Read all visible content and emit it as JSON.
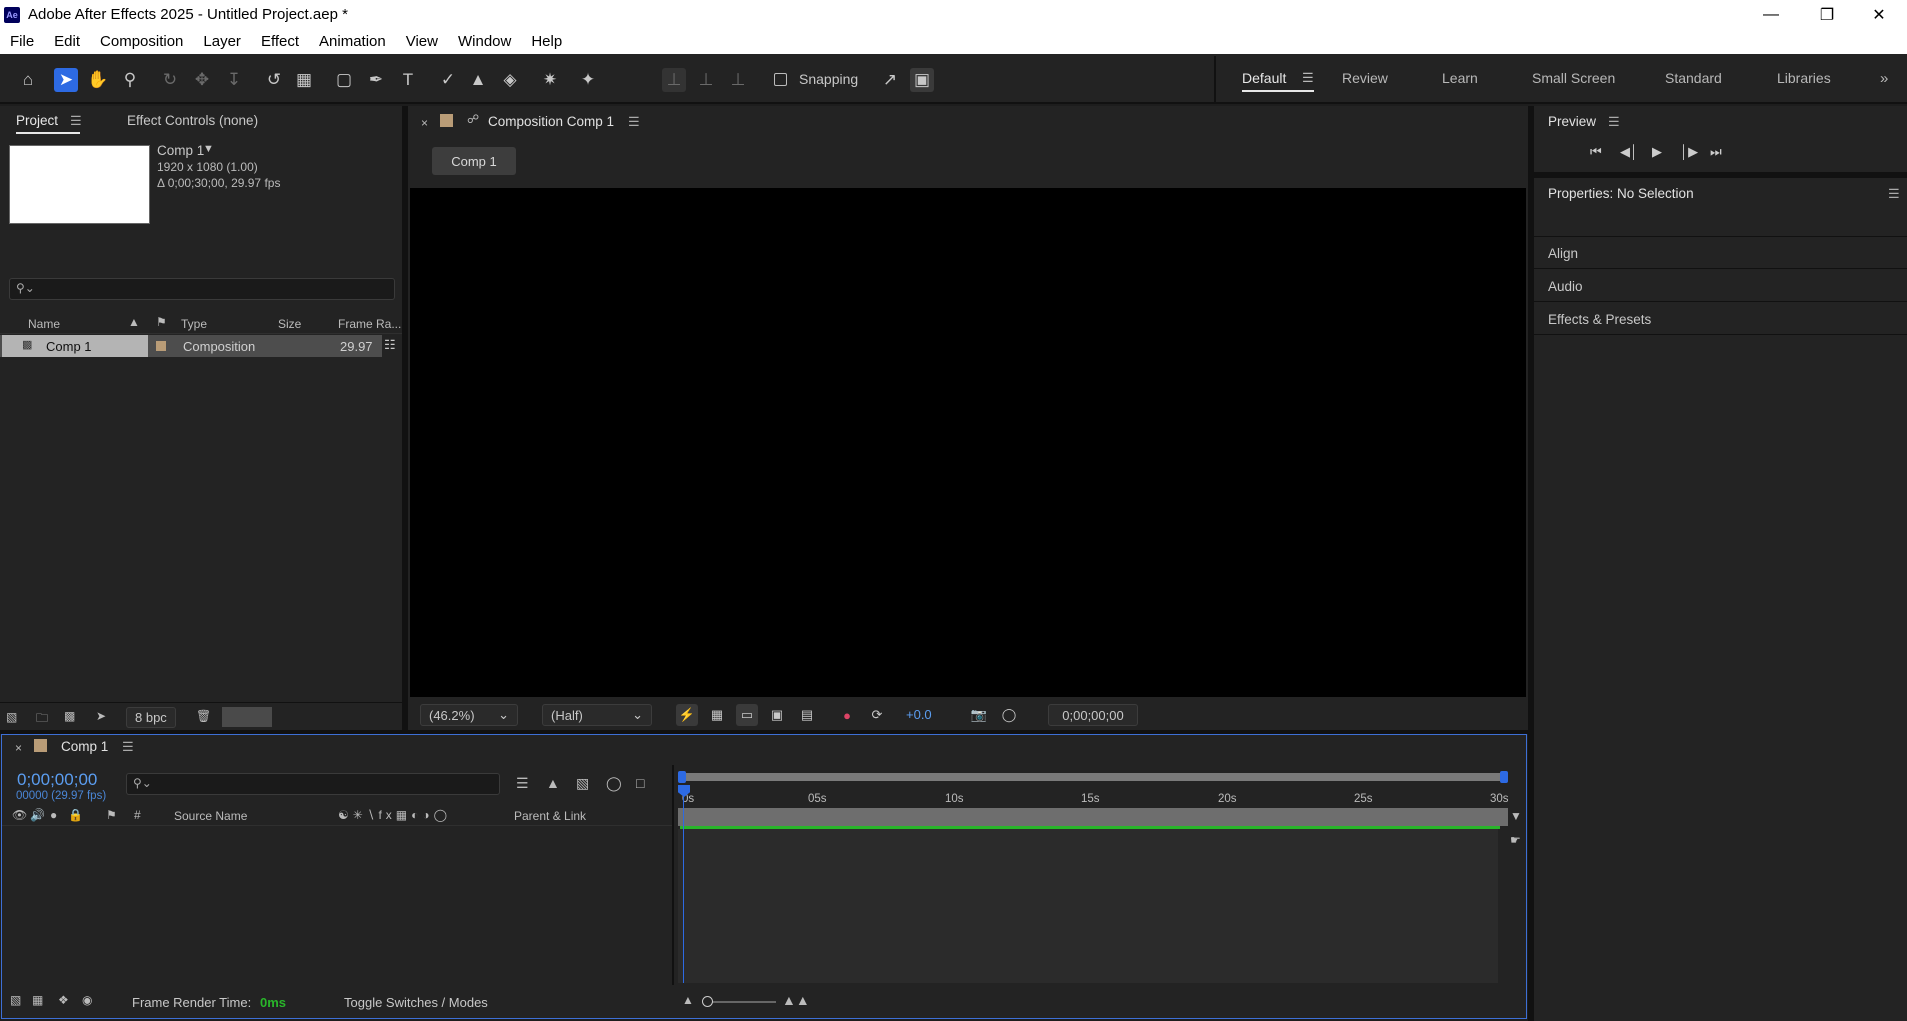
{
  "window": {
    "title": "Adobe After Effects 2025 - Untitled Project.aep *",
    "logo": "Ae"
  },
  "menu": [
    "File",
    "Edit",
    "Composition",
    "Layer",
    "Effect",
    "Animation",
    "View",
    "Window",
    "Help"
  ],
  "toolbar": {
    "snapping_label": "Snapping"
  },
  "workspaces": {
    "items": [
      "Default",
      "Review",
      "Learn",
      "Small Screen",
      "Standard",
      "Libraries"
    ],
    "active": "Default"
  },
  "project": {
    "tab_label": "Project",
    "effect_controls_label": "Effect Controls (none)",
    "comp_name": "Comp 1",
    "comp_size": "1920 x 1080 (1.00)",
    "comp_duration": "Δ 0;00;30;00, 29.97 fps",
    "columns": {
      "name": "Name",
      "type": "Type",
      "size": "Size",
      "framerate": "Frame Ra..."
    },
    "items": [
      {
        "name": "Comp 1",
        "type": "Composition",
        "size": "",
        "framerate": "29.97"
      }
    ],
    "bpc_label": "8 bpc"
  },
  "composition": {
    "tab_label": "Composition Comp 1",
    "breadcrumb": "Comp 1",
    "zoom": "(46.2%)",
    "resolution": "(Half)",
    "exposure": "+0.0",
    "timecode": "0;00;00;00"
  },
  "preview": {
    "title": "Preview"
  },
  "properties": {
    "title": "Properties: No Selection"
  },
  "side_panels": [
    "Align",
    "Audio",
    "Effects & Presets"
  ],
  "timeline": {
    "tab_label": "Comp 1",
    "current_time": "0;00;00;00",
    "frame_info": "00000 (29.97 fps)",
    "source_name_label": "Source Name",
    "parent_link_label": "Parent & Link",
    "ruler_ticks": [
      "0s",
      "05s",
      "10s",
      "15s",
      "20s",
      "25s",
      "30s"
    ],
    "frame_render_label": "Frame Render Time:",
    "frame_render_value": "0ms",
    "toggle_label": "Toggle Switches / Modes"
  },
  "colors": {
    "accent": "#2d6ae3",
    "timecode": "#5b9df0",
    "green_bar": "#29b52a",
    "label_tan": "#b99c77"
  }
}
